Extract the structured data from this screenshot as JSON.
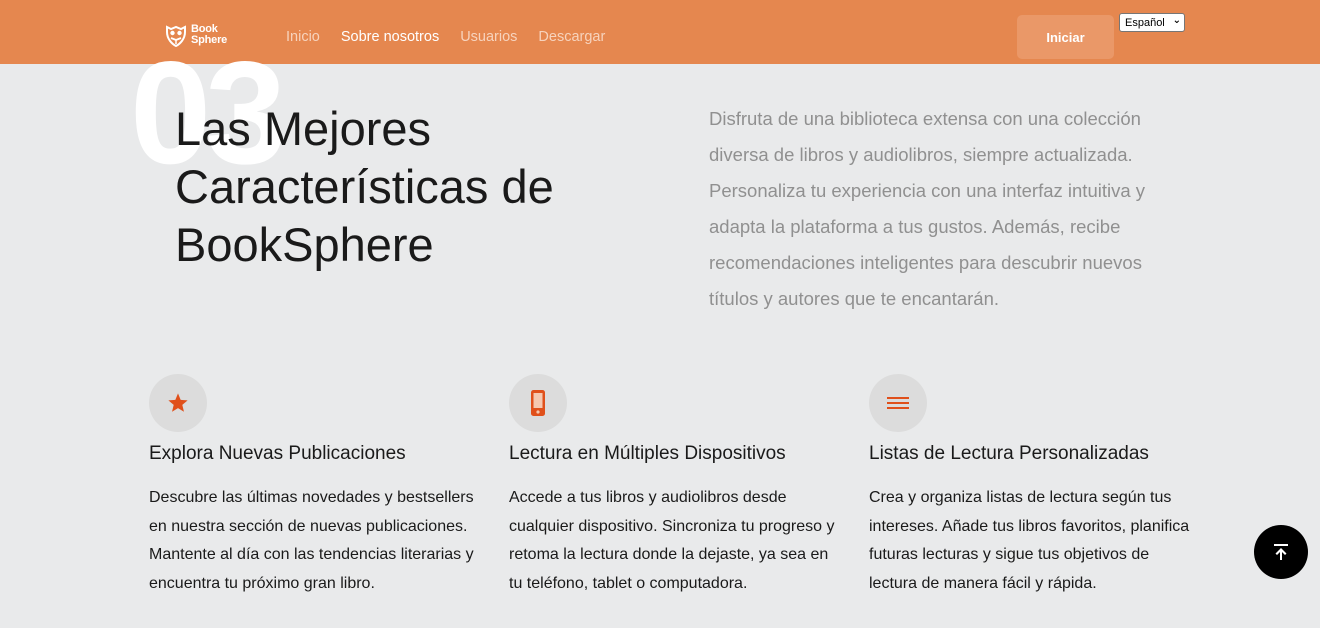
{
  "nav": {
    "logo": {
      "line1": "Book",
      "line2": "Sphere",
      "icon": "owl-book-icon"
    },
    "links": [
      "Inicio",
      "Sobre nosotros",
      "Usuarios",
      "Descargar"
    ],
    "active_link": "Sobre nosotros",
    "login_label": "Iniciar",
    "language": {
      "selected": "Español"
    }
  },
  "hero": {
    "number": "03",
    "title": "Las Mejores Características de BookSphere",
    "description": "Disfruta de una biblioteca extensa con una colección diversa de libros y audiolibros, siempre actualizada. Personaliza tu experiencia con una interfaz intuitiva y adapta la plataforma a tus gustos. Además, recibe recomendaciones inteligentes para descubrir nuevos títulos y autores que te encantarán."
  },
  "features": [
    {
      "icon": "star-icon",
      "title": "Explora Nuevas Publicaciones",
      "text": "Descubre las últimas novedades y bestsellers en nuestra sección de nuevas publicaciones. Mantente al día con las tendencias literarias y encuentra tu próximo gran libro."
    },
    {
      "icon": "mobile-phone-icon",
      "title": "Lectura en Múltiples Dispositivos",
      "text": "Accede a tus libros y audiolibros desde cualquier dispositivo. Sincroniza tu progreso y retoma la lectura donde la dejaste, ya sea en tu teléfono, tablet o computadora."
    },
    {
      "icon": "list-icon",
      "title": "Listas de Lectura Personalizadas",
      "text": "Crea y organiza listas de lectura según tus intereses. Añade tus libros favoritos, planifica futuras lecturas y sigue tus objetivos de lectura de manera fácil y rápida."
    }
  ],
  "colors": {
    "brand": "#e5874f",
    "accent_icon": "#e0501b",
    "background": "#e9eaeb"
  }
}
